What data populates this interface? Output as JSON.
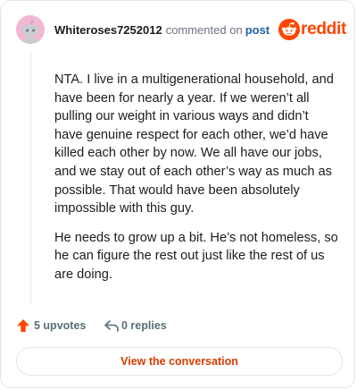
{
  "comment": {
    "username": "Whiteroses7252012",
    "action_text": "commented on",
    "post_link": "post",
    "paragraphs": [
      "NTA. I live in a multigenerational household, and have been for nearly a year. If we weren’t all pulling our weight in various ways and didn’t have genuine respect for each other, we’d have killed each other by now. We all have our jobs, and we stay out of each other’s way as much as possible. That would have been absolutely impossible with this guy.",
      "He needs to grow up a bit. He’s not homeless, so he can figure the rest out just like the rest of us are doing."
    ]
  },
  "brand": {
    "name": "reddit",
    "color": "#ff4500"
  },
  "footer": {
    "upvotes_label": "5 upvotes",
    "replies_label": "0 replies"
  },
  "cta": {
    "label": "View the conversation"
  },
  "colors": {
    "accent_orange": "#ff4500",
    "link_blue": "#1f61a8",
    "avatar_pink": "#f3b7d4",
    "cta_text": "#d93a00"
  },
  "icons": {
    "avatar": "snoo-avatar",
    "logo": "reddit-snoo-icon",
    "upvote": "upvote-arrow-icon",
    "reply": "reply-arrow-icon"
  }
}
